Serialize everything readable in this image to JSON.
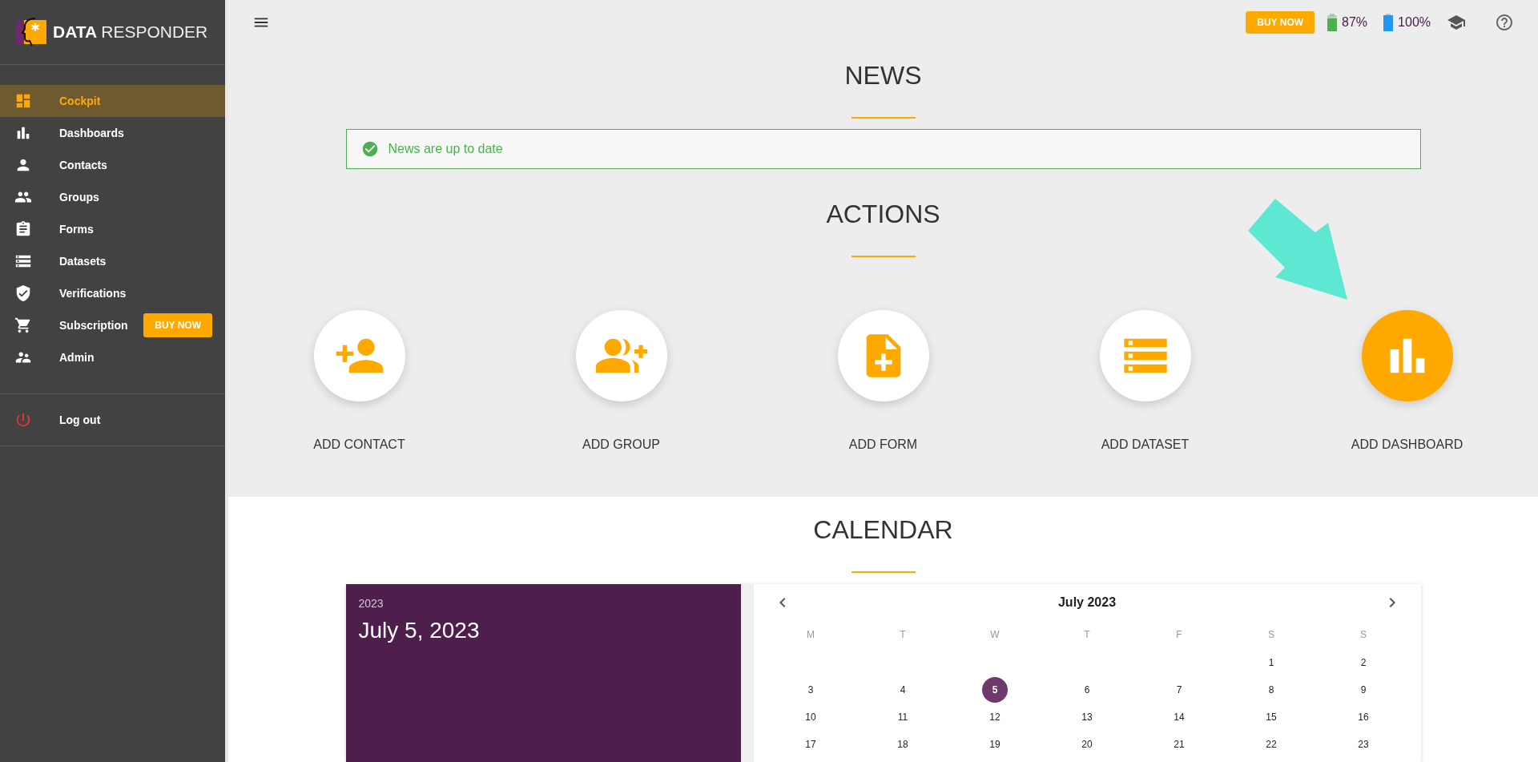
{
  "sidebar": {
    "logo": {
      "bold": "DATA",
      "light": "RESPONDER"
    },
    "items": [
      {
        "label": "Cockpit",
        "selected": true
      },
      {
        "label": "Dashboards",
        "selected": false
      },
      {
        "label": "Contacts",
        "selected": false
      },
      {
        "label": "Groups",
        "selected": false
      },
      {
        "label": "Forms",
        "selected": false
      },
      {
        "label": "Datasets",
        "selected": false
      },
      {
        "label": "Verifications",
        "selected": false
      },
      {
        "label": "Subscription",
        "selected": false,
        "badge": "BUY NOW"
      },
      {
        "label": "Admin",
        "selected": false
      }
    ],
    "logout": {
      "label": "Log out"
    }
  },
  "topbar": {
    "buy_button": "BUY NOW",
    "battery_1": "87%",
    "battery_2": "100%"
  },
  "news": {
    "title": "NEWS",
    "message": "News are up to date"
  },
  "actions": {
    "title": "ACTIONS",
    "items": [
      {
        "label": "ADD CONTACT",
        "highlighted": false
      },
      {
        "label": "ADD GROUP",
        "highlighted": false
      },
      {
        "label": "ADD FORM",
        "highlighted": false
      },
      {
        "label": "ADD DATASET",
        "highlighted": false
      },
      {
        "label": "ADD DASHBOARD",
        "highlighted": true
      }
    ]
  },
  "calendar": {
    "title": "CALENDAR",
    "year": "2023",
    "date": "July 5, 2023",
    "month": "July 2023",
    "weekdays": [
      "M",
      "T",
      "W",
      "T",
      "F",
      "S",
      "S"
    ],
    "weeks": [
      [
        {
          "label": "1",
          "selected": false
        },
        {
          "label": "2",
          "selected": false
        }
      ],
      [
        {
          "label": "3",
          "selected": false
        },
        {
          "label": "4",
          "selected": false
        },
        {
          "label": "5",
          "selected": true
        },
        {
          "label": "6",
          "selected": false
        },
        {
          "label": "7",
          "selected": false
        },
        {
          "label": "8",
          "selected": false
        },
        {
          "label": "9",
          "selected": false
        }
      ],
      [
        {
          "label": "10",
          "selected": false
        },
        {
          "label": "11",
          "selected": false
        },
        {
          "label": "12",
          "selected": false
        },
        {
          "label": "13",
          "selected": false
        },
        {
          "label": "14",
          "selected": false
        },
        {
          "label": "15",
          "selected": false
        },
        {
          "label": "16",
          "selected": false
        }
      ],
      [
        {
          "label": "17",
          "selected": false
        },
        {
          "label": "18",
          "selected": false
        },
        {
          "label": "19",
          "selected": false
        },
        {
          "label": "20",
          "selected": false
        },
        {
          "label": "21",
          "selected": false
        },
        {
          "label": "22",
          "selected": false
        },
        {
          "label": "23",
          "selected": false
        }
      ]
    ]
  }
}
